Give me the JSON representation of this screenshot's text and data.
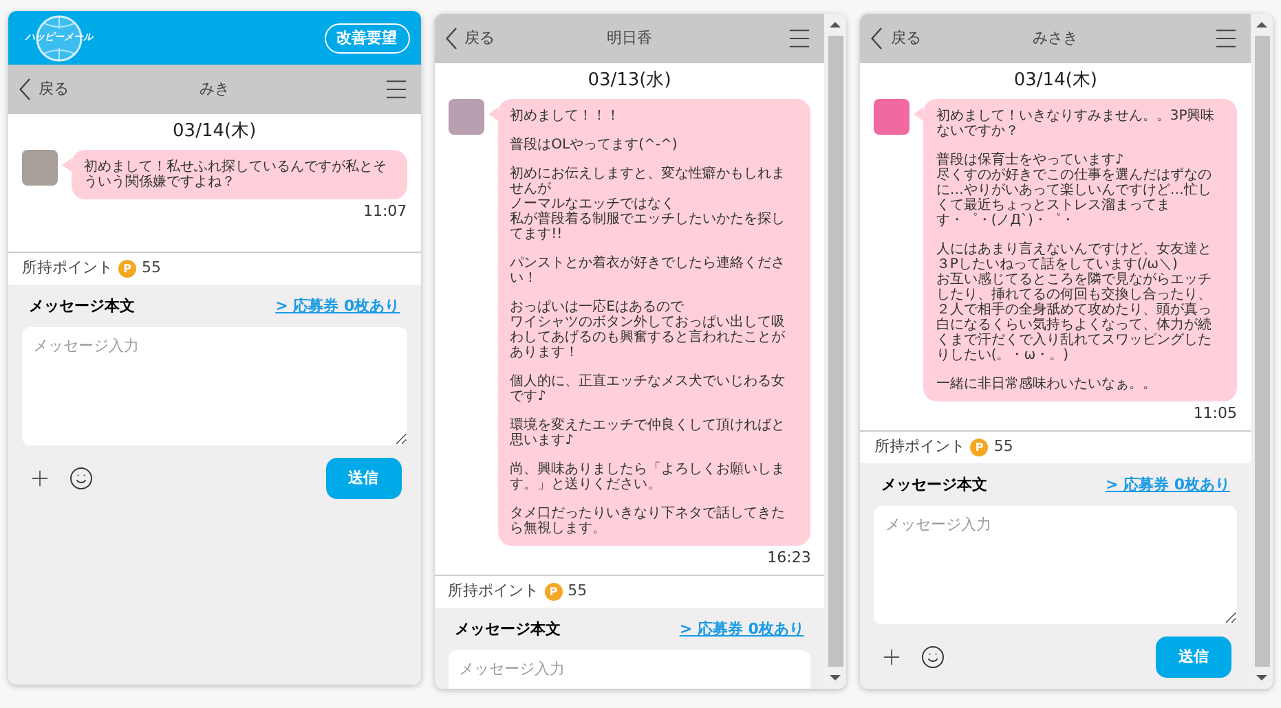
{
  "panels": [
    {
      "app_header": {
        "logo_text": "ハッピーメール",
        "button": "改善要望"
      },
      "nav": {
        "back": "戻る",
        "title": "みき"
      },
      "scrollbar": false,
      "date": "03/14(木)",
      "messages": [
        {
          "paragraphs": [
            [
              "初めまして！私せふれ探しているんですが私とそういう関係嫌ですよね？"
            ]
          ],
          "time": "11:07"
        }
      ],
      "points": {
        "label": "所持ポイント",
        "coin": "P",
        "value": "55"
      },
      "compose": {
        "label": "メッセージ本文",
        "link": "> 応募券 0枚あり",
        "placeholder": "メッセージ入力",
        "send_button": "送信"
      }
    },
    {
      "nav": {
        "back": "戻る",
        "title": "明日香"
      },
      "scrollbar": true,
      "date": "03/13(水)",
      "messages": [
        {
          "paragraphs": [
            [
              "初めまして！！！"
            ],
            [
              "普段はOLやってます(^-^)"
            ],
            [
              "初めにお伝えしますと、変な性癖かもしれませんが",
              "ノーマルなエッチではなく",
              "私が普段着る制服でエッチしたいかたを探してます!!"
            ],
            [
              "パンストとか着衣が好きでしたら連絡ください！"
            ],
            [
              "おっぱいは一応Eはあるので",
              "ワイシャツのボタン外しておっぱい出して吸わしてあげるのも興奮すると言われたことがあります！"
            ],
            [
              "個人的に、正直エッチなメス犬でいじわる女です♪"
            ],
            [
              "環境を変えたエッチで仲良くして頂ければと思います♪"
            ],
            [
              "尚、興味ありましたら「よろしくお願いします。」と送りください。"
            ],
            [
              "タメ口だったりいきなり下ネタで話してきたら無視します。"
            ]
          ],
          "time": "16:23"
        }
      ],
      "points": {
        "label": "所持ポイント",
        "coin": "P",
        "value": "55"
      },
      "compose": {
        "label": "メッセージ本文",
        "link": "> 応募券 0枚あり",
        "placeholder": "メッセージ入力"
      }
    },
    {
      "nav": {
        "back": "戻る",
        "title": "みさき"
      },
      "scrollbar": true,
      "date": "03/14(木)",
      "messages": [
        {
          "paragraphs": [
            [
              "初めまして！いきなりすみません。。3P興味ないですか？"
            ],
            [
              "普段は保育士をやっています♪",
              "尽くすのが好きでこの仕事を選んだはずなのに…やりがいあって楽しいんですけど…忙しくて最近ちょっとストレス溜まってます・゜・(ノД`)・゜・"
            ],
            [
              "人にはあまり言えないんですけど、女友達と３Pしたいねって話をしています(/ω＼)",
              "お互い感じてるところを隣で見ながらエッチしたり、挿れてるの何回も交換し合ったり、２人で相手の全身舐めて攻めたり、頭が真っ白になるくらい気持ちよくなって、体力が続くまで汗だくで入り乱れてスワッピングしたりしたい(。・ω・。)"
            ],
            [
              "一緒に非日常感味わいたいなぁ。。"
            ]
          ],
          "time": "11:05"
        }
      ],
      "points": {
        "label": "所持ポイント",
        "coin": "P",
        "value": "55"
      },
      "compose": {
        "label": "メッセージ本文",
        "link": "> 応募券 0枚あり",
        "placeholder": "メッセージ入力",
        "send_button": "送信"
      }
    }
  ]
}
